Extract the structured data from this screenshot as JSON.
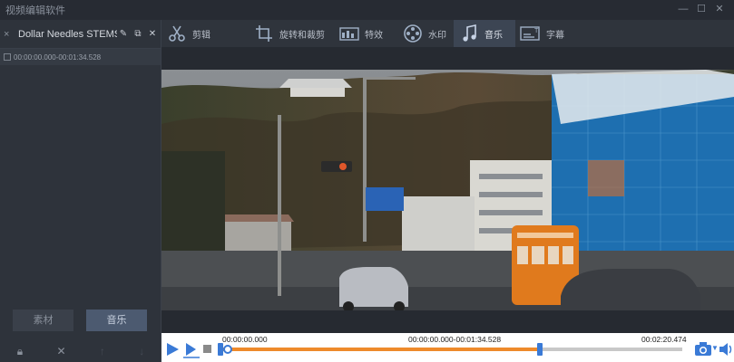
{
  "window": {
    "title": "视频编辑软件",
    "minimize_icon": "minimize-icon",
    "maximize_icon": "maximize-icon",
    "close_icon": "close-icon"
  },
  "left_panel": {
    "title": "Dollar Needles STEMS...",
    "segment": "00:00:00.000-00:01:34.528",
    "buttons": [
      "素材",
      "音乐"
    ],
    "active_button": 1,
    "bottom_icons": [
      "lock-icon",
      "delete-icon",
      "move-up-icon",
      "move-down-icon"
    ]
  },
  "tabs": [
    {
      "label": "剪辑",
      "icon": "scissors-icon"
    },
    {
      "label": "旋转和裁剪",
      "icon": "crop-icon"
    },
    {
      "label": "特效",
      "icon": "effects-icon"
    },
    {
      "label": "水印",
      "icon": "film-reel-icon"
    },
    {
      "label": "音乐",
      "icon": "music-note-icon"
    },
    {
      "label": "字幕",
      "icon": "subtitle-icon"
    }
  ],
  "active_tab": 4,
  "player": {
    "start_time": "00:00:00.000",
    "range": "00:00:00.000-00:01:34.528",
    "end_time": "00:02:20.474",
    "selection_fraction": 0.69,
    "colors": {
      "accent": "#3a7ad6",
      "progress": "#ee8a2b"
    }
  }
}
